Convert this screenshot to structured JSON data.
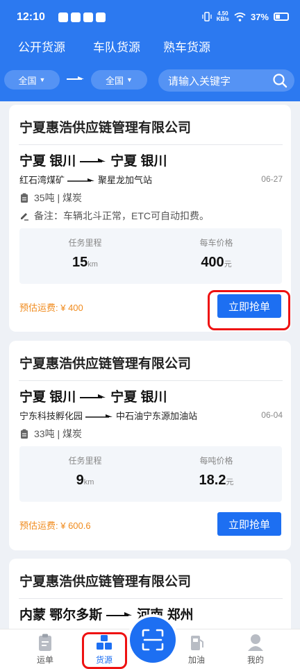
{
  "status_bar": {
    "time": "12:10",
    "net_speed_value": "4.50",
    "net_speed_unit": "KB/s",
    "battery": "37%"
  },
  "tabs": [
    {
      "label": "公开货源"
    },
    {
      "label": "车队货源"
    },
    {
      "label": "熟车货源"
    }
  ],
  "filters": {
    "origin": "全国",
    "destination": "全国",
    "search_placeholder": "请输入关键字"
  },
  "cards": [
    {
      "company": "宁夏惠浩供应链管理有限公司",
      "from_city": "宁夏 银川",
      "to_city": "宁夏 银川",
      "from_place": "红石湾煤矿",
      "to_place": "聚星龙加气站",
      "date": "06-27",
      "cargo": "35吨 | 煤炭",
      "note": "备注：车辆北斗正常，ETC可自动扣费。",
      "metric_1_label": "任务里程",
      "metric_1_value": "15",
      "metric_1_unit": "km",
      "metric_2_label": "每车价格",
      "metric_2_value": "400",
      "metric_2_unit": "元",
      "freight": "预估运费: ¥ 400",
      "button": "立即抢单"
    },
    {
      "company": "宁夏惠浩供应链管理有限公司",
      "from_city": "宁夏 银川",
      "to_city": "宁夏 银川",
      "from_place": "宁东科技孵化园",
      "to_place": "中石油宁东源加油站",
      "date": "06-04",
      "cargo": "33吨 | 煤炭",
      "metric_1_label": "任务里程",
      "metric_1_value": "9",
      "metric_1_unit": "km",
      "metric_2_label": "每吨价格",
      "metric_2_value": "18.2",
      "metric_2_unit": "元",
      "freight": "预估运费: ¥ 600.6",
      "button": "立即抢单"
    },
    {
      "company": "宁夏惠浩供应链管理有限公司",
      "from_city": "内蒙 鄂尔多斯",
      "to_city": "河南 郑州"
    }
  ],
  "bottom_nav": [
    {
      "label": "运单"
    },
    {
      "label": "货源"
    },
    {
      "label": "加油"
    },
    {
      "label": "我的"
    }
  ],
  "colors": {
    "header": "#2c79f0",
    "accent": "#1d6ff2",
    "freight": "#f08a1c",
    "highlight": "#e11111"
  }
}
